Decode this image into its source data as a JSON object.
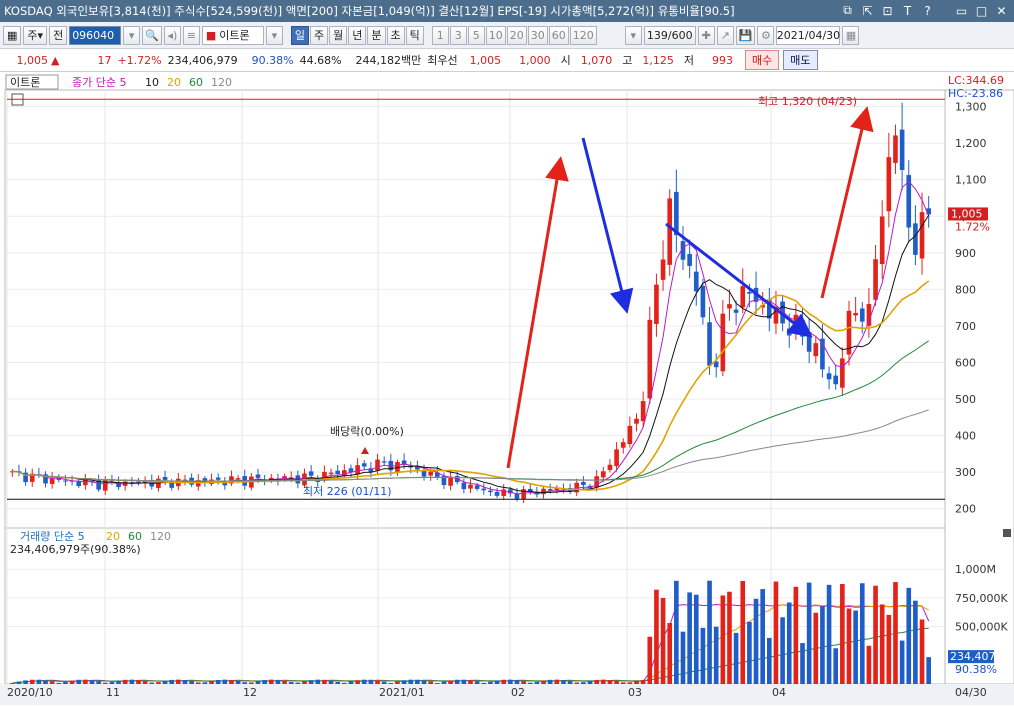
{
  "title_bar": {
    "text": "KOSDAQ 외국인보유[3,814(천)] 주식수[524,599(천)] 액면[200] 자본금[1,049(억)] 결산[12월] EPS[-19] 시가총액[5,272(억)] 유통비율[90.5]",
    "icons": [
      "restore-icon",
      "share-icon",
      "resize-icon",
      "font-icon",
      "help-icon",
      "minimize-icon",
      "maximize-icon",
      "close-icon"
    ]
  },
  "toolbar": {
    "period_select": "주",
    "prev_label": "전",
    "code_value": "096040",
    "name_value": "이트론",
    "tabs": [
      "일",
      "주",
      "월",
      "년",
      "분",
      "초",
      "틱"
    ],
    "active_tab": "일",
    "intervals": [
      "1",
      "3",
      "5",
      "10",
      "20",
      "30",
      "60",
      "120"
    ],
    "count": "139/600",
    "date": "2021/04/30"
  },
  "quote": {
    "price": "1,005",
    "arrow": "▲",
    "change": "17",
    "change_pct": "+1.72%",
    "volume": "234,406,979",
    "vol_ratio": "90.38%",
    "turnover": "44.68%",
    "amount": "244,182백만",
    "best_ask_label": "최우선",
    "best_ask": "1,005",
    "best_bid": "1,000",
    "open_label": "시",
    "open": "1,070",
    "high_label": "고",
    "high": "1,125",
    "low_label": "저",
    "low": "993",
    "buy_label": "매수",
    "sell_label": "매도"
  },
  "chart": {
    "stock_tag": "이트론",
    "price_legend": "종가 단순 5",
    "ma_labels": [
      "10",
      "20",
      "60",
      "120"
    ],
    "ma_colors": {
      "ma5": "#c218c2",
      "ma10": "#111111",
      "ma20": "#e0a400",
      "ma60": "#1e8a3a",
      "ma120": "#8a8a8a"
    },
    "up_color": "#e3231a",
    "down_color": "#1f5ec9",
    "lc_label": "LC:344.69",
    "hc_label": "HC:-23.86",
    "high_annotation": "최고 1,320 (04/23)",
    "low_annotation": "최저 226 (01/11)",
    "dividend_annotation": "배당락(0.00%)",
    "last_price_tag": "1,005",
    "last_pct_tag": "1.72%",
    "y_ticks": [
      "1,300",
      "1,200",
      "1,100",
      "1,000",
      "900",
      "800",
      "700",
      "600",
      "500",
      "400",
      "300",
      "200"
    ],
    "volume_legend": "거래량 단순 5",
    "volume_ma_labels": [
      "20",
      "60",
      "120"
    ],
    "volume_value": "234,406,979주(90.38%)",
    "volume_y_ticks": [
      "1,000M",
      "750,000K",
      "500,000K"
    ],
    "volume_tag": "234,407K",
    "volume_pct_tag": "90.38%",
    "x_labels": [
      "2020/10",
      "11",
      "12",
      "2021/01",
      "02",
      "03",
      "04"
    ],
    "x_end_label": "04/30"
  }
}
